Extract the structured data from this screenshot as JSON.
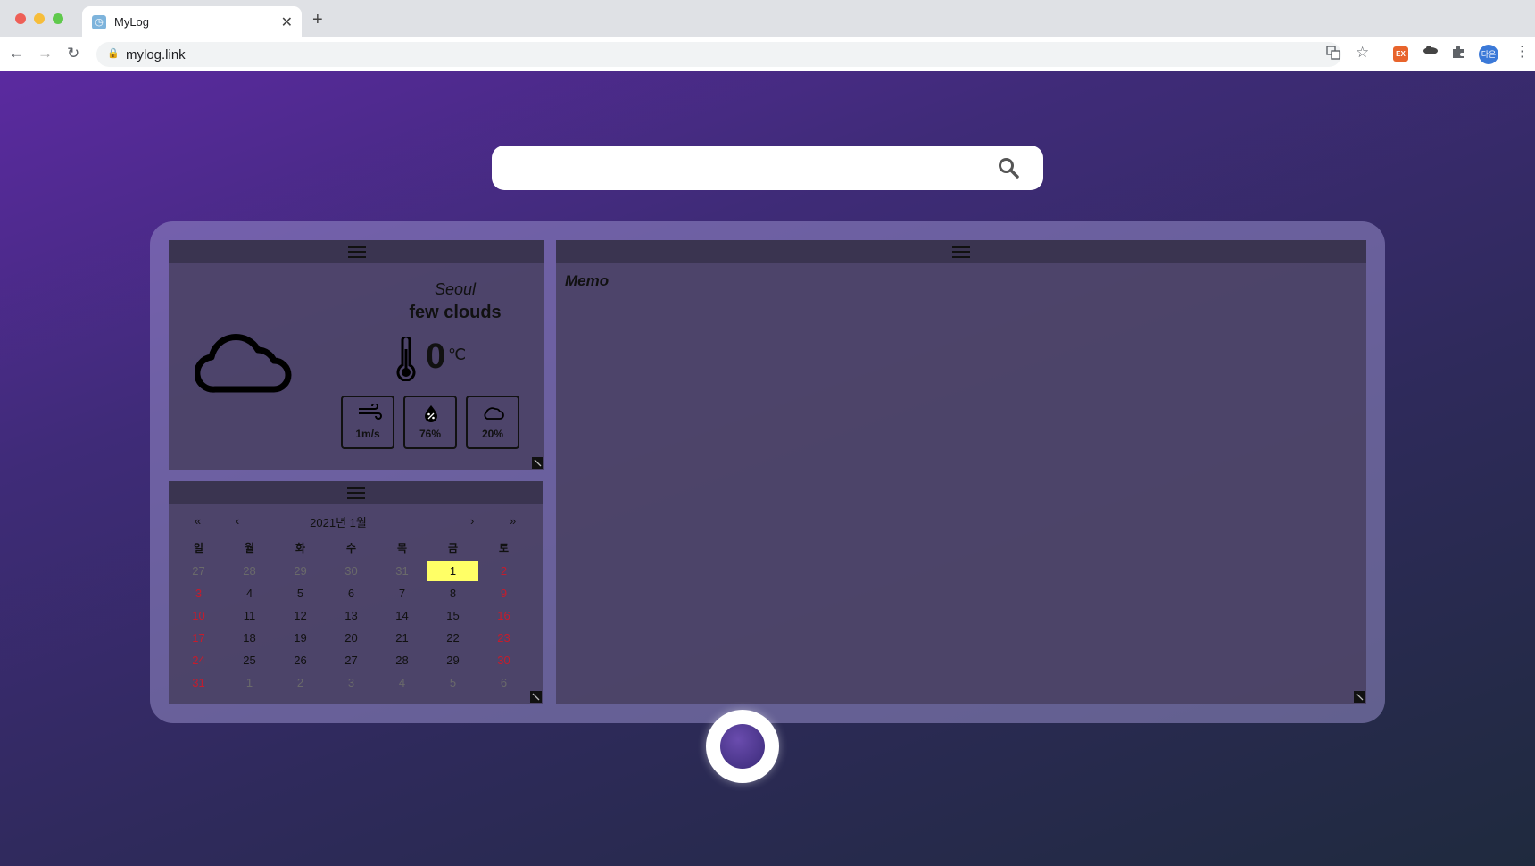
{
  "browser": {
    "tab_title": "MyLog",
    "favicon": "◷",
    "close": "✕",
    "new_tab": "+",
    "url": "mylog.link",
    "lock": "🔒",
    "ext_ex": "EX",
    "profile": "다은"
  },
  "search": {
    "placeholder": "",
    "value": ""
  },
  "weather": {
    "city": "Seoul",
    "description": "few clouds",
    "temp": "0",
    "unit": "℃",
    "wind": "1m/s",
    "humidity": "76%",
    "clouds": "20%"
  },
  "calendar": {
    "title": "2021년 1월",
    "prev_year": "«",
    "prev_month": "‹",
    "next_month": "›",
    "next_year": "»",
    "weekdays": [
      "일",
      "월",
      "화",
      "수",
      "목",
      "금",
      "토"
    ],
    "weeks": [
      [
        "27",
        "28",
        "29",
        "30",
        "31",
        "1",
        "2"
      ],
      [
        "3",
        "4",
        "5",
        "6",
        "7",
        "8",
        "9"
      ],
      [
        "10",
        "11",
        "12",
        "13",
        "14",
        "15",
        "16"
      ],
      [
        "17",
        "18",
        "19",
        "20",
        "21",
        "22",
        "23"
      ],
      [
        "24",
        "25",
        "26",
        "27",
        "28",
        "29",
        "30"
      ],
      [
        "31",
        "1",
        "2",
        "3",
        "4",
        "5",
        "6"
      ]
    ],
    "selected_day": "1"
  },
  "memo": {
    "title": "Memo"
  }
}
